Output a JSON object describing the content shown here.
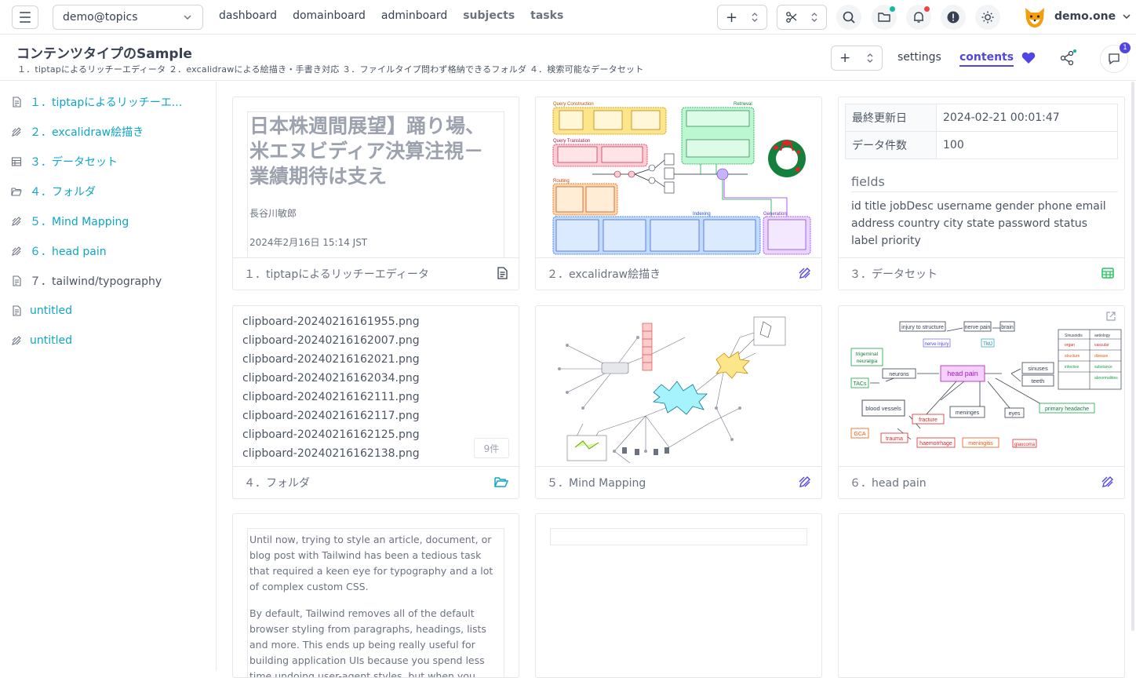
{
  "topbar": {
    "workspace": "demo@topics",
    "nav": [
      "dashboard",
      "domainboard",
      "adminboard",
      "subjects",
      "tasks"
    ],
    "username": "demo.one",
    "add_symbol": "+",
    "notif_dot_color": "#ef4444",
    "folder_dot_color": "#14b8a6"
  },
  "subheader": {
    "title": "コンテンツタイプのSample",
    "subtitle": "１．tiptapによるリッチーエディータ ２．excalidrawによる絵描き・手書き対応 ３．ファイルタイプ問わず格納できるフォルダ ４．検索可能なデータセット",
    "add_symbol": "+",
    "settings": "settings",
    "contents": "contents",
    "chat_badge": "1"
  },
  "sidebar": {
    "items": [
      {
        "label": "１．tiptapによるリッチーエ...",
        "icon": "document-icon"
      },
      {
        "label": "２．excalidraw絵描き",
        "icon": "draw-icon"
      },
      {
        "label": "３．データセット",
        "icon": "table-icon"
      },
      {
        "label": "４．フォルダ",
        "icon": "folder-icon"
      },
      {
        "label": "５．Mind Mapping",
        "icon": "draw-icon"
      },
      {
        "label": "６．head pain",
        "icon": "draw-icon"
      },
      {
        "label": "７．tailwind/typography",
        "icon": "document-icon"
      },
      {
        "label": "untitled",
        "icon": "document-icon"
      },
      {
        "label": "untitled",
        "icon": "draw-icon"
      }
    ]
  },
  "cards": {
    "c1": {
      "title": "日本株週間展望】踊り場、米エヌビディア決算注視－業績期待は支え",
      "author": "長谷川敏郎",
      "date": "2024年2月16日 15:14 JST",
      "footer": "１．tiptapによるリッチーエディータ"
    },
    "c2": {
      "footer": "２．excalidraw絵描き"
    },
    "c3": {
      "rows": [
        {
          "key": "最終更新日",
          "value": "2024-02-21 00:01:47"
        },
        {
          "key": "データ件数",
          "value": "100"
        }
      ],
      "fields_label": "fields",
      "fields": "id title jobDesc username gender phone email address country city state password status label priority",
      "footer": "３．データセット"
    },
    "c4": {
      "files": [
        "clipboard-20240216161955.png",
        "clipboard-20240216162007.png",
        "clipboard-20240216162021.png",
        "clipboard-20240216162034.png",
        "clipboard-20240216162111.png",
        "clipboard-20240216162117.png",
        "clipboard-20240216162125.png",
        "clipboard-20240216162138.png"
      ],
      "count": "9件",
      "footer": "４．フォルダ"
    },
    "c5": {
      "footer": "５．Mind Mapping"
    },
    "c6": {
      "footer": "６．head pain",
      "diagram": {
        "center": "head pain",
        "nodes": [
          "injury to structure",
          "nerve pain",
          "brain",
          "nerve injury",
          "TMJ",
          "trigeminal neuralgia",
          "neurons",
          "TACs",
          "sinuses",
          "teeth",
          "blood vessels",
          "fracture",
          "meninges",
          "eyes",
          "primary headache",
          "GCA",
          "trauma",
          "haemorrhage",
          "meningitis",
          "glaucoma"
        ],
        "table": [
          "Sinusoidis",
          "aetiology",
          "organ",
          "vascular",
          "disease",
          "structure",
          "infective",
          "substance",
          "abnormalities"
        ]
      }
    },
    "c7": {
      "paragraphs": [
        "Until now, trying to style an article, document, or blog post with Tailwind has been a tedious task that required a keen eye for typography and a lot of complex custom CSS.",
        "By default, Tailwind removes all of the default browser styling from paragraphs, headings, lists and more. This ends up being really useful for building application UIs because you spend less time undoing user-agent styles, but when you really are just trying"
      ]
    }
  },
  "colors": {
    "accent": "#4f46e5",
    "link": "#0ea5c6",
    "border": "#e5e7eb",
    "dataset_icon": "#22c55e",
    "folder_icon": "#0ea5c6"
  }
}
